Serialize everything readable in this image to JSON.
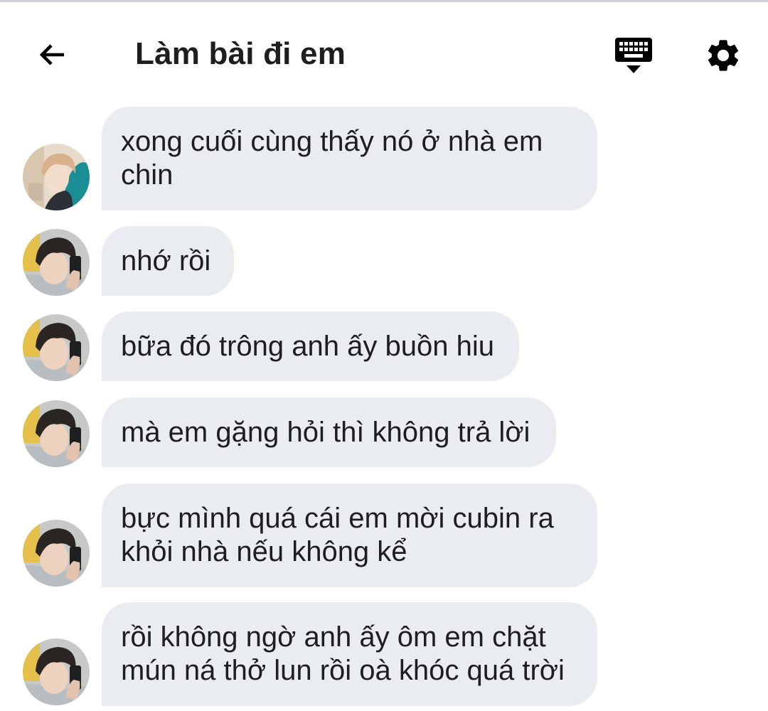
{
  "header": {
    "title": "Làm bài đi em",
    "back_icon": "arrow-left-icon",
    "keyboard_icon": "keyboard-hide-icon",
    "settings_icon": "gear-icon"
  },
  "colors": {
    "bubble": "#e9edf2",
    "text": "#1c1e21",
    "icon": "#000000"
  },
  "messages": [
    {
      "avatar": "avatar-teal-hoodie",
      "text": "xong cuối cùng thấy nó ở nhà em\nchin"
    },
    {
      "avatar": "avatar-phone-selfie",
      "text": "nhớ rồi"
    },
    {
      "avatar": "avatar-phone-selfie",
      "text": "bữa đó trông anh ấy buồn hiu"
    },
    {
      "avatar": "avatar-phone-selfie",
      "text": "mà em gặng hỏi thì không trả lời"
    },
    {
      "avatar": "avatar-phone-selfie",
      "text": "bực mình quá cái em mời cubin ra\nkhỏi nhà nếu không kể"
    },
    {
      "avatar": "avatar-phone-selfie",
      "text": "rồi không ngờ anh ấy ôm em chặt\nmún ná thở lun rồi oà khóc quá trời"
    }
  ]
}
